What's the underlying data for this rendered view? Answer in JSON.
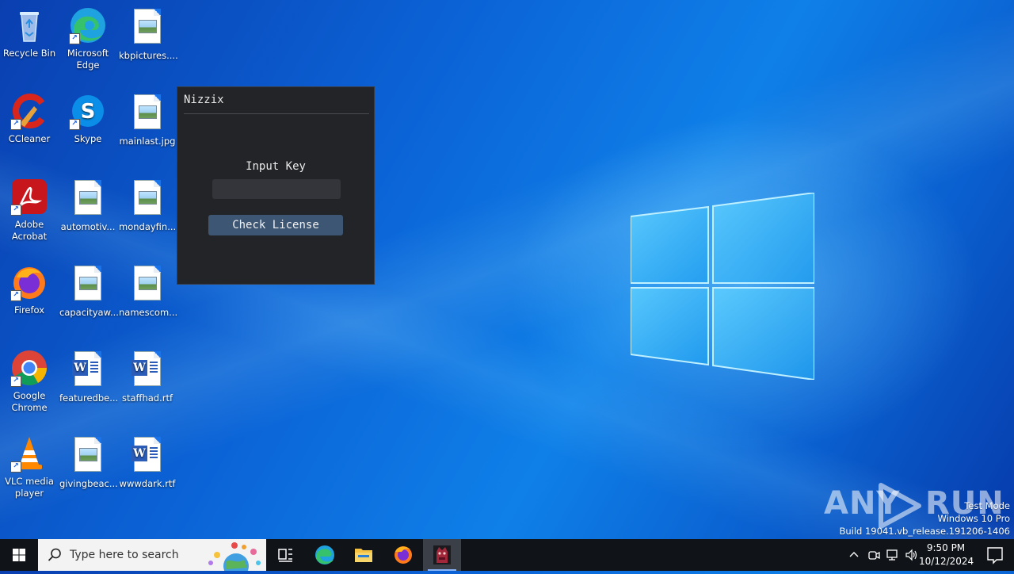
{
  "desktop": {
    "icons": [
      {
        "label": "Recycle Bin"
      },
      {
        "label": "Microsoft Edge"
      },
      {
        "label": "kbpictures...."
      },
      {
        "label": "CCleaner"
      },
      {
        "label": "Skype"
      },
      {
        "label": "mainlast.jpg"
      },
      {
        "label": "Adobe Acrobat"
      },
      {
        "label": "automotiv..."
      },
      {
        "label": "mondayfin..."
      },
      {
        "label": "Firefox"
      },
      {
        "label": "capacityaw..."
      },
      {
        "label": "namescom..."
      },
      {
        "label": "Google Chrome"
      },
      {
        "label": "featuredbe..."
      },
      {
        "label": "staffhad.rtf"
      },
      {
        "label": "VLC media player"
      },
      {
        "label": "givingbeac..."
      },
      {
        "label": "wwwdark.rtf"
      }
    ]
  },
  "app": {
    "title": "Nizzix",
    "key_label": "Input Key",
    "key_value": "",
    "check_button": "Check License"
  },
  "watermark": {
    "brand_left": "ANY",
    "brand_right": "RUN",
    "mode": "Test Mode",
    "edition": "Windows 10 Pro",
    "build": "Build 19041.vb_release.191206-1406"
  },
  "taskbar": {
    "search_placeholder": "Type here to search",
    "time": "9:50 PM",
    "date": "10/12/2024",
    "colors": {
      "bar": "#101418",
      "active": "#3b4048",
      "accent": "#8ab4f8"
    }
  },
  "icons": [
    "start-icon",
    "search-icon",
    "task-view-icon",
    "edge-icon",
    "file-explorer-icon",
    "firefox-icon",
    "nizzix-app-icon",
    "chevron-up-icon",
    "meet-now-icon",
    "network-icon",
    "volume-icon",
    "notification-icon"
  ]
}
